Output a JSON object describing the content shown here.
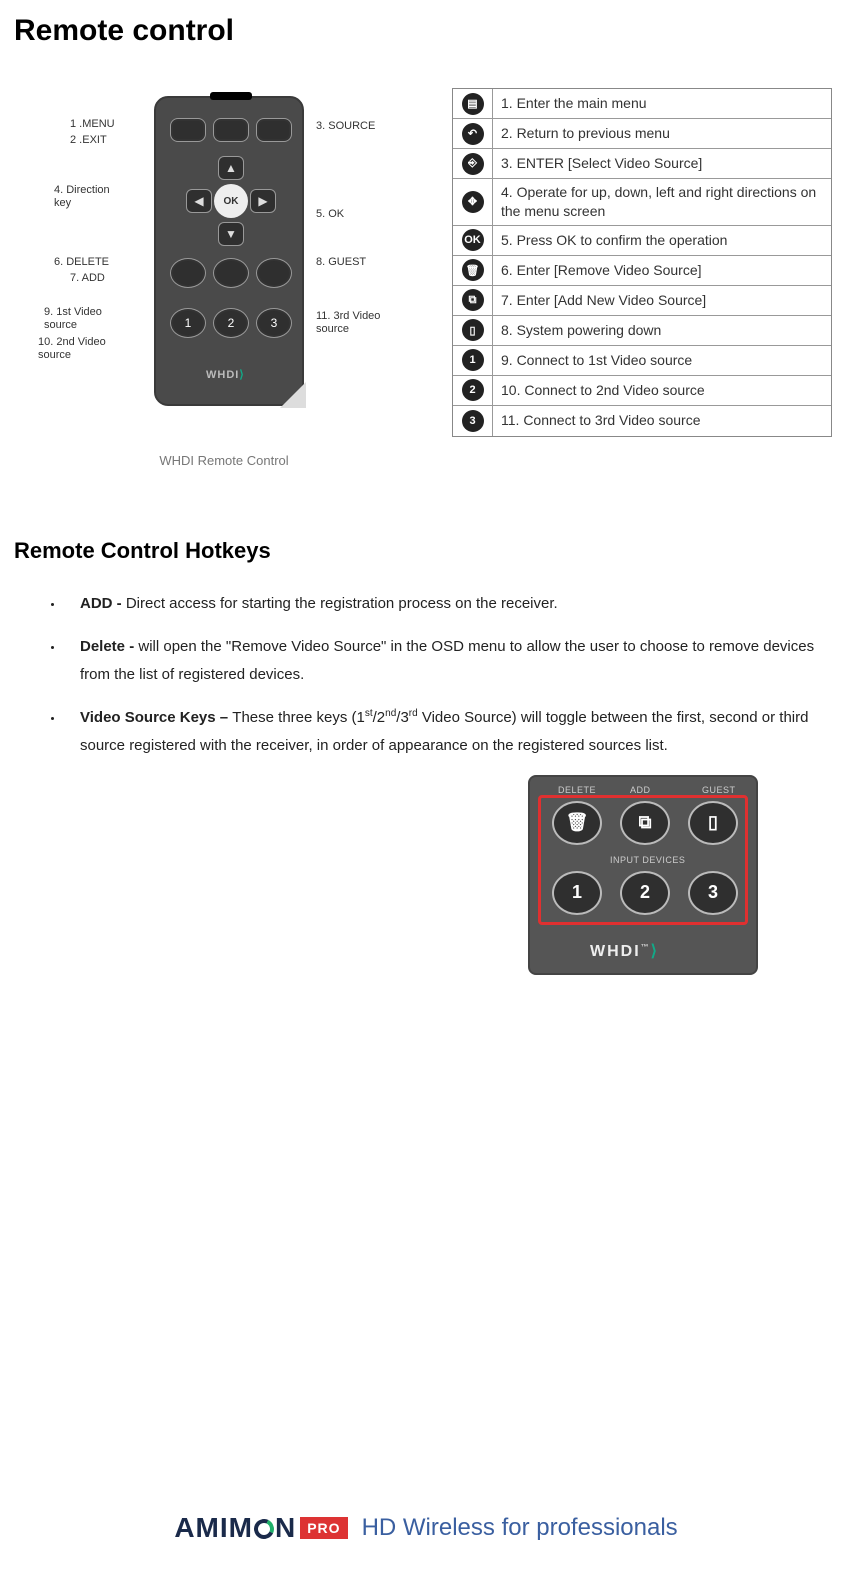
{
  "title": "Remote control",
  "remote_caption": "WHDI Remote Control",
  "remote_logo": "WHDI",
  "callouts": {
    "menu": "1 .MENU",
    "exit": "2 .EXIT",
    "source": "3. SOURCE",
    "direction": "4. Direction key",
    "ok": "5. OK",
    "delete": "6. DELETE",
    "add": "7. ADD",
    "guest": "8. GUEST",
    "vs1": "9. 1st Video source",
    "vs2": "10. 2nd Video source",
    "vs3": "11. 3rd Video source"
  },
  "ok_label": "OK",
  "num1": "1",
  "num2": "2",
  "num3": "3",
  "fn_table": [
    {
      "icon": "▤",
      "text": "1. Enter the main menu"
    },
    {
      "icon": "↶",
      "text": "2. Return to previous menu"
    },
    {
      "icon": "⎆",
      "text": "3. ENTER [Select Video Source]"
    },
    {
      "icon": "✥",
      "text": "4. Operate for up, down, left and right directions on the menu screen"
    },
    {
      "icon": "OK",
      "text": "5. Press OK to confirm the operation"
    },
    {
      "icon": "🗑",
      "text": "6. Enter [Remove Video Source]"
    },
    {
      "icon": "⧉",
      "text": "7. Enter [Add New Video Source]"
    },
    {
      "icon": "▯",
      "text": "8. System powering down"
    },
    {
      "icon": "1",
      "text": "9. Connect to 1st Video source"
    },
    {
      "icon": "2",
      "text": "10. Connect to 2nd Video source"
    },
    {
      "icon": "3",
      "text": "11. Connect to 3rd Video source"
    }
  ],
  "subtitle": "Remote Control Hotkeys",
  "hotkeys": {
    "add_label": "ADD - ",
    "add_text": "Direct access for starting the registration process on the receiver.",
    "delete_label": "Delete - ",
    "delete_text": "will open the \"Remove Video Source\" in the OSD menu to allow the user to choose to remove devices from the list of registered devices.",
    "vsk_label": "Video Source Keys – ",
    "vsk_text_a": "These three keys (1",
    "vsk_sup1": "st",
    "vsk_text_b": "/2",
    "vsk_sup2": "nd",
    "vsk_text_c": "/3",
    "vsk_sup3": "rd",
    "vsk_text_d": " Video Source) will toggle between the first, second or third source registered with the receiver, in order of appearance on the registered sources list."
  },
  "closeup": {
    "delete": "DELETE",
    "add": "ADD",
    "guest": "GUEST",
    "input": "INPUT DEVICES",
    "n1": "1",
    "n2": "2",
    "n3": "3",
    "logo": "WHDI",
    "tm": "™"
  },
  "footer": {
    "brand": "AMIM",
    "brand2": "N",
    "pro": "PRO",
    "tagline": "HD Wireless for professionals"
  }
}
